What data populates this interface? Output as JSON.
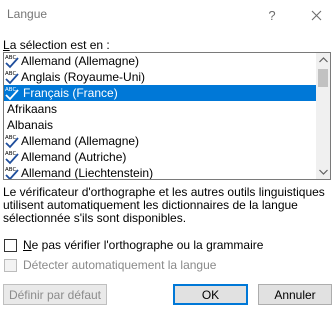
{
  "window": {
    "title": "Langue",
    "help_label": "?"
  },
  "selection_label": "La sélection est en :",
  "languages": [
    {
      "label": "Allemand (Allemagne)",
      "spell_icon": true,
      "selected": false
    },
    {
      "label": "Anglais (Royaume-Uni)",
      "spell_icon": true,
      "selected": false
    },
    {
      "label": "Français (France)",
      "spell_icon": true,
      "selected": true
    },
    {
      "label": "Afrikaans",
      "spell_icon": false,
      "selected": false
    },
    {
      "label": "Albanais",
      "spell_icon": false,
      "selected": false
    },
    {
      "label": "Allemand (Allemagne)",
      "spell_icon": true,
      "selected": false
    },
    {
      "label": "Allemand (Autriche)",
      "spell_icon": true,
      "selected": false
    },
    {
      "label": "Allemand (Liechtenstein)",
      "spell_icon": true,
      "selected": false
    }
  ],
  "description": "Le vérificateur d'orthographe et les autres outils linguistiques utilisent automatiquement les dictionnaires de la langue sélectionnée s'ils sont disponibles.",
  "options": {
    "no_spellcheck": {
      "label": "Ne pas vérifier l'orthographe ou la grammaire",
      "checked": false
    },
    "auto_detect": {
      "label": "Détecter automatiquement la langue",
      "checked": false,
      "disabled": true
    }
  },
  "buttons": {
    "set_default": "Définir par défaut",
    "ok": "OK",
    "cancel": "Annuler"
  },
  "colors": {
    "selection": "#0078d7",
    "spell_check_mark": "#1f4e9c"
  }
}
